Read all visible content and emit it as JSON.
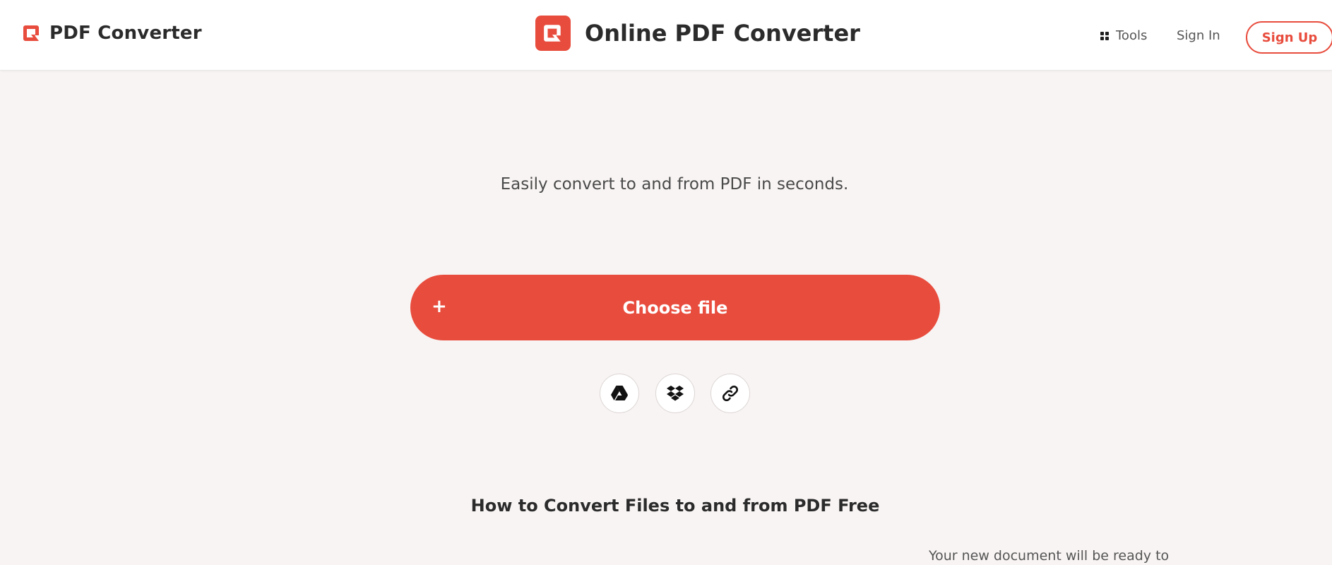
{
  "header": {
    "brand_name": "PDF Converter",
    "center_title": "Online PDF Converter",
    "nav": {
      "tools_label": "Tools",
      "signin_label": "Sign In",
      "signup_label": "Sign Up"
    }
  },
  "main": {
    "tagline": "Easily convert to and from PDF in seconds.",
    "choose_file": {
      "plus": "+",
      "label": "Choose file"
    },
    "sources": [
      {
        "icon": "google-drive-icon"
      },
      {
        "icon": "dropbox-icon"
      },
      {
        "icon": "link-icon"
      }
    ],
    "howto_title": "How to Convert Files to and from PDF Free",
    "step_text_partial": "Your new document will be ready to"
  },
  "colors": {
    "accent": "#e84c3d",
    "page_bg": "#f8f4f3",
    "header_bg": "#ffffff",
    "text": "#2b2b2b"
  }
}
